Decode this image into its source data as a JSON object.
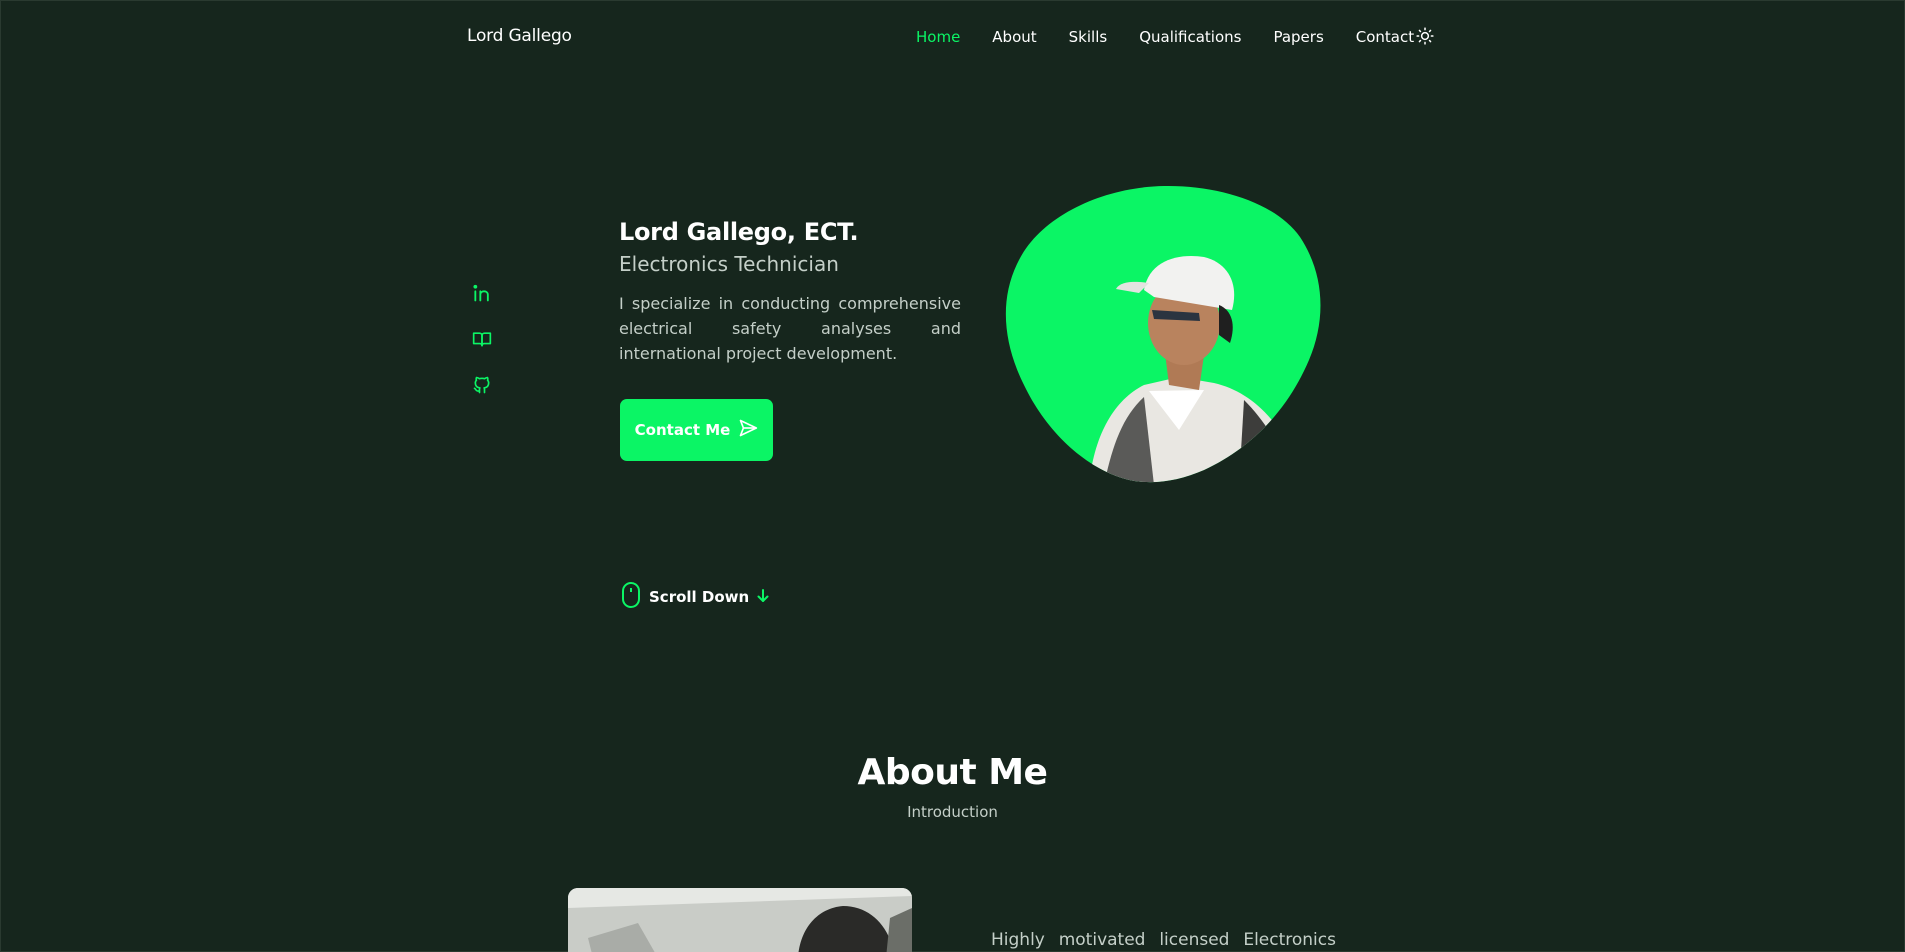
{
  "header": {
    "logo": "Lord Gallego",
    "nav": [
      {
        "label": "Home",
        "active": true
      },
      {
        "label": "About",
        "active": false
      },
      {
        "label": "Skills",
        "active": false
      },
      {
        "label": "Qualifications",
        "active": false
      },
      {
        "label": "Papers",
        "active": false
      },
      {
        "label": "Contact",
        "active": false
      }
    ],
    "theme_icon": "sun-icon"
  },
  "social": [
    {
      "icon": "linkedin-icon"
    },
    {
      "icon": "book-open-icon"
    },
    {
      "icon": "github-icon"
    }
  ],
  "hero": {
    "name": "Lord Gallego, ECT.",
    "role": "Electronics Technician",
    "description": "I specialize in conducting comprehensive electrical safety analyses and international project development.",
    "cta_label": "Contact Me",
    "cta_icon": "send-icon",
    "scroll_label": "Scroll Down",
    "scroll_icon": "mouse-icon",
    "scroll_arrow_icon": "arrow-down-icon"
  },
  "about": {
    "title": "About Me",
    "subtitle": "Introduction",
    "text_words": [
      "Highly",
      "motivated",
      "licensed",
      "Electronics"
    ]
  },
  "colors": {
    "background": "#16261d",
    "accent": "#0bf565",
    "text": "#ffffff",
    "muted": "#c4cfc8"
  }
}
